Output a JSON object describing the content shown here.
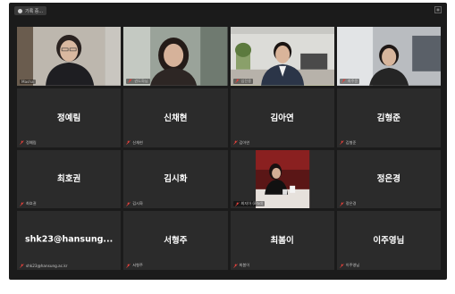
{
  "window": {
    "recording_label": "기록 중..."
  },
  "participants": [
    {
      "id": "p1",
      "tile_label": "Masha",
      "video": true
    },
    {
      "id": "p2",
      "tile_label": "권도화님",
      "video": true
    },
    {
      "id": "p3",
      "tile_label": "임진용",
      "video": true,
      "active_speaker": true
    },
    {
      "id": "p4",
      "tile_label": "최주윤",
      "video": true
    },
    {
      "id": "p5",
      "display_name": "정예림",
      "tile_label": "정예림",
      "video": false
    },
    {
      "id": "p6",
      "display_name": "신채현",
      "tile_label": "신채현",
      "video": false
    },
    {
      "id": "p7",
      "display_name": "김아연",
      "tile_label": "김아연",
      "video": false
    },
    {
      "id": "p8",
      "display_name": "김형준",
      "tile_label": "김형준",
      "video": false
    },
    {
      "id": "p9",
      "display_name": "최호권",
      "tile_label": "최호권",
      "video": false
    },
    {
      "id": "p10",
      "display_name": "김시화",
      "tile_label": "김시화",
      "video": false
    },
    {
      "id": "p11",
      "tile_label": "최지아 (iPad)",
      "video": true
    },
    {
      "id": "p12",
      "display_name": "정은경",
      "tile_label": "정은경",
      "video": false
    },
    {
      "id": "p13",
      "display_name": "shk23@hansung...",
      "tile_label": "shk23@hansung.ac.kr",
      "video": false
    },
    {
      "id": "p14",
      "display_name": "서형주",
      "tile_label": "서형주",
      "video": false
    },
    {
      "id": "p15",
      "display_name": "최봄이",
      "tile_label": "최봄이",
      "video": false
    },
    {
      "id": "p16",
      "display_name": "이주영님",
      "tile_label": "이주영님",
      "video": false
    }
  ],
  "colors": {
    "background": "#1b1b1b",
    "tile": "#2b2b2b",
    "active_border": "#b7d53d",
    "muted_icon": "#e0413b"
  },
  "icons": {
    "mute": "microphone-muted-icon",
    "recording": "recording-icon"
  }
}
